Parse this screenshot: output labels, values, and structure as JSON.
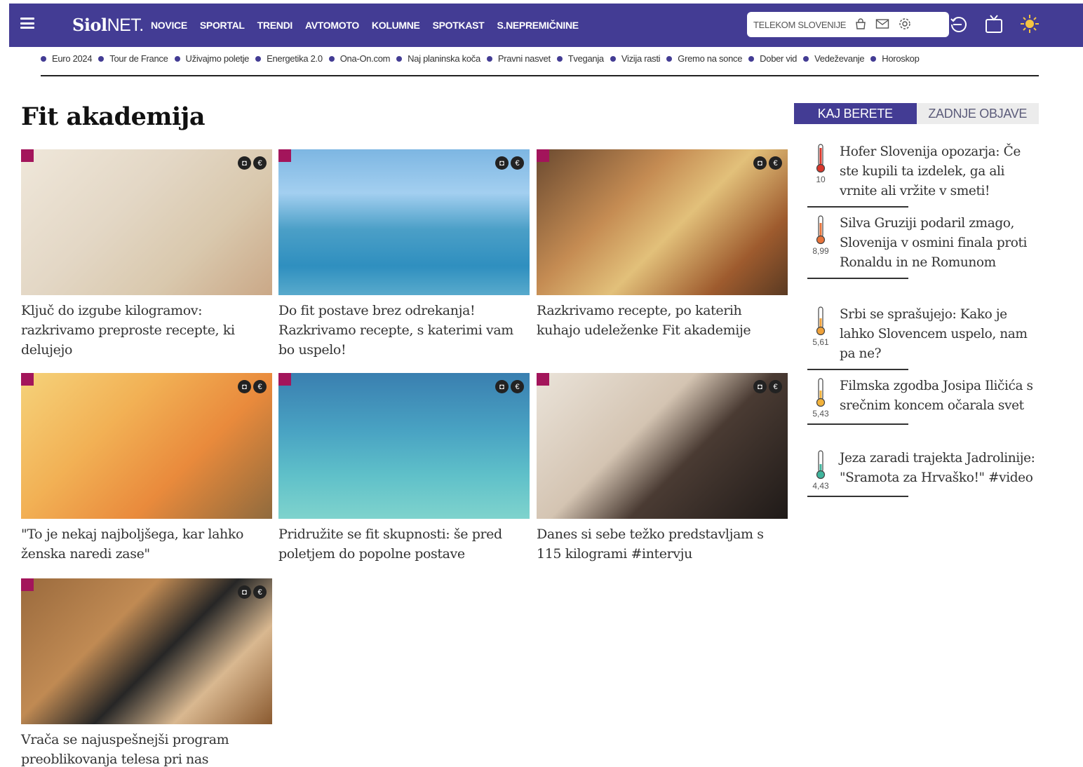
{
  "header": {
    "logo_bold": "Siol",
    "logo_light": "NET.",
    "nav": [
      "NOVICE",
      "SPORTAL",
      "TRENDI",
      "AVTOMOTO",
      "KOLUMNE",
      "SPOTKAST",
      "S.NEPREMIČNINE"
    ],
    "telekom_label": "TELEKOM SLOVENIJE"
  },
  "tags": [
    "Euro 2024",
    "Tour de France",
    "Uživajmo poletje",
    "Energetika 2.0",
    "Ona-On.com",
    "Naj planinska koča",
    "Pravni nasvet",
    "Tveganja",
    "Vizija rasti",
    "Gremo na sonce",
    "Dober vid",
    "Vedeževanje",
    "Horoskop"
  ],
  "page": {
    "title": "Fit akademija"
  },
  "articles": [
    {
      "title": "Ključ do izgube kilogramov: razkrivamo preproste recepte, ki delujejo"
    },
    {
      "title": "Do fit postave brez odrekanja! Razkrivamo recepte, s katerimi vam bo uspelo!"
    },
    {
      "title": "Razkrivamo recepte, po katerih kuhajo udeleženke Fit akademije"
    },
    {
      "title": "\"To je nekaj najboljšega, kar lahko ženska naredi zase\""
    },
    {
      "title": "Pridružite se fit skupnosti: še pred poletjem do popolne postave"
    },
    {
      "title": "Danes si sebe težko predstavljam s 115 kilogrami #intervju"
    },
    {
      "title": "Vrača se najuspešnejši program preoblikovanja telesa pri nas"
    }
  ],
  "sidebar": {
    "tabs": [
      "KAJ BERETE",
      "ZADNJE OBJAVE"
    ],
    "items": [
      {
        "score": "10",
        "title": "Hofer Slovenija opozarja: Če ste kupili ta izdelek, ga ali vrnite ali vržite v smeti!",
        "color": "#d9362b"
      },
      {
        "score": "8,99",
        "title": "Silva Gruziji podaril zmago, Slovenija v osmini finala proti Ronaldu in ne Romunom",
        "color": "#e8733a"
      },
      {
        "score": "5,61",
        "title": "Srbi se sprašujejo: Kako je lahko Slovencem uspelo, nam pa ne?",
        "color": "#f0a23a"
      },
      {
        "score": "5,43",
        "title": "Filmska zgodba Josipa Iličića s srečnim koncem očarala svet",
        "color": "#f2b23a"
      },
      {
        "score": "4,43",
        "title": "Jeza zaradi trajekta Jadrolinije: \"Sramota za Hrvaško!\" #video",
        "color": "#3fb59d"
      }
    ]
  }
}
